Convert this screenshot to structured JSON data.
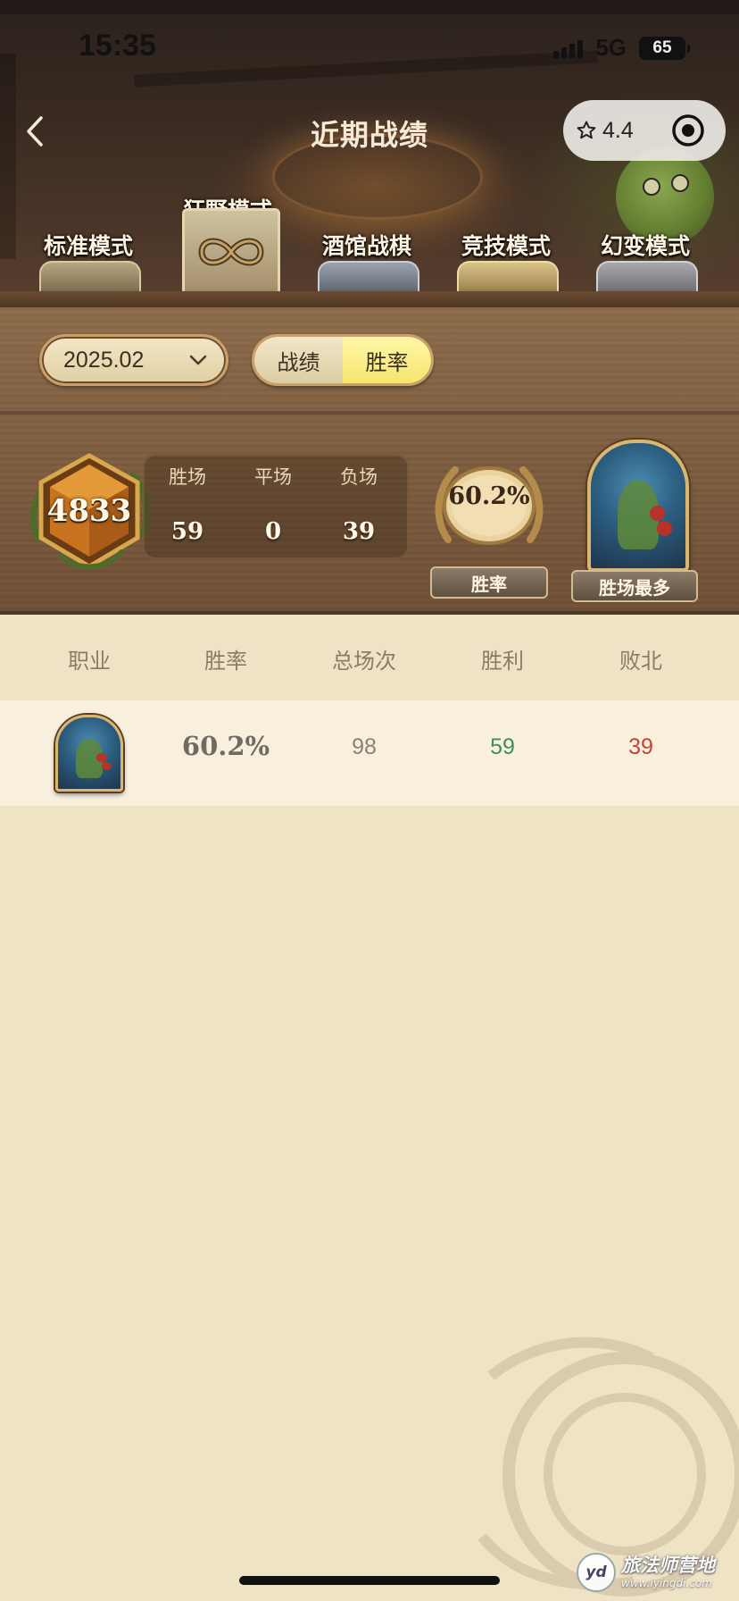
{
  "status_bar": {
    "time": "15:35",
    "network": "5G",
    "battery": "65"
  },
  "nav": {
    "title": "近期战绩",
    "capsule_rating": "4.4",
    "back_icon": "chevron-left-icon",
    "rating_icon": "star-outline-icon",
    "target_icon": "target-icon"
  },
  "mode_tabs": [
    {
      "label": "标准模式",
      "active": false
    },
    {
      "label": "狂野模式",
      "active": true,
      "icon": "infinity-icon"
    },
    {
      "label": "酒馆战棋",
      "active": false
    },
    {
      "label": "竞技模式",
      "active": false
    },
    {
      "label": "幻变模式",
      "active": false
    }
  ],
  "filters": {
    "date": "2025.02",
    "view_toggle": [
      {
        "label": "战绩",
        "selected": false
      },
      {
        "label": "胜率",
        "selected": true
      }
    ]
  },
  "summary": {
    "rank_value": "4833",
    "stats": [
      {
        "label": "胜场",
        "value": "59"
      },
      {
        "label": "平场",
        "value": "0"
      },
      {
        "label": "负场",
        "value": "39"
      }
    ],
    "win_rate_value": "60.2%",
    "win_rate_label": "胜率",
    "top_hero_label": "胜场最多"
  },
  "table": {
    "headers": [
      "职业",
      "胜率",
      "总场次",
      "胜利",
      "败北"
    ],
    "rows": [
      {
        "hero_icon": "hero-portrait-icon",
        "win_rate": "60.2%",
        "total": "98",
        "wins": "59",
        "losses": "39"
      }
    ]
  },
  "branding": {
    "logo_mark": "yd",
    "name": "旅法师营地",
    "url": "www.iyingdi.com"
  },
  "colors": {
    "win": "#3f8e62",
    "loss": "#c1443a",
    "toggle_active": "#f6e56e",
    "parchment": "#efe3c6",
    "wood": "#7d5d3f"
  }
}
